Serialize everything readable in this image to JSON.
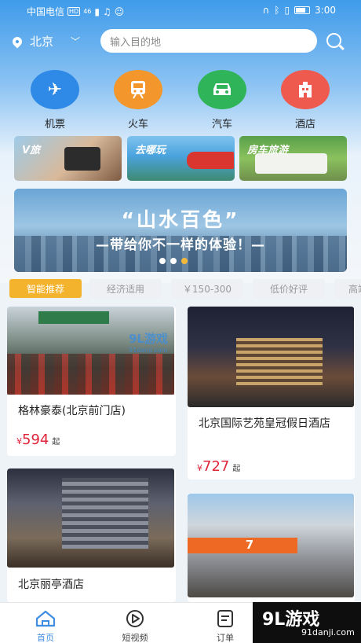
{
  "status_bar": {
    "carrier": "中国电信",
    "hd": "HD",
    "signal": "46",
    "time": "3:00"
  },
  "header": {
    "city": "北京",
    "search_placeholder": "输入目的地"
  },
  "categories": [
    {
      "label": "机票",
      "icon": "plane-icon",
      "color": "#2e8ae6"
    },
    {
      "label": "火车",
      "icon": "train-icon",
      "color": "#f3962b"
    },
    {
      "label": "汽车",
      "icon": "car-icon",
      "color": "#2fb45a"
    },
    {
      "label": "酒店",
      "icon": "hotel-icon",
      "color": "#ef5a4e"
    }
  ],
  "promos": [
    {
      "label": "V旅"
    },
    {
      "label": "去哪玩"
    },
    {
      "label": "房车旅游"
    }
  ],
  "banner": {
    "title": "“山水百色”",
    "subtitle": "—带给你不一样的体验！—",
    "page_count": 3,
    "active_page": 3
  },
  "filters": [
    "智能推荐",
    "经济适用",
    "￥150-300",
    "低价好评",
    "高端"
  ],
  "hotels": [
    {
      "name": "格林豪泰(北京前门店)",
      "currency": "¥",
      "price": "594",
      "suffix": "起"
    },
    {
      "name": "北京国际艺苑皇冠假日酒店",
      "currency": "¥",
      "price": "727",
      "suffix": "起"
    },
    {
      "name": "北京丽亭酒店"
    },
    {
      "name": ""
    }
  ],
  "watermark": {
    "small": "9L游戏",
    "small_url": "91danji.com",
    "big": "9L游戏",
    "big_url": "91danji.com"
  },
  "nav": [
    {
      "label": "首页",
      "icon": "home-icon"
    },
    {
      "label": "短视频",
      "icon": "play-icon"
    },
    {
      "label": "订单",
      "icon": "order-icon"
    }
  ],
  "colors": {
    "accent": "#3f8de0",
    "price": "#e0243a",
    "filter_active": "#f3b32c"
  }
}
